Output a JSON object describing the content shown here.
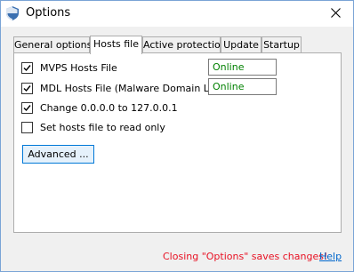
{
  "window": {
    "title": "Options",
    "icon": "shield-icon",
    "close_icon": "close-icon"
  },
  "tabs": [
    {
      "label": "General options",
      "active": false
    },
    {
      "label": "Hosts file",
      "active": true
    },
    {
      "label": "Active protection",
      "active": false
    },
    {
      "label": "Update",
      "active": false
    },
    {
      "label": "Startup",
      "active": false
    }
  ],
  "hosts_tab": {
    "options": [
      {
        "label": "MVPS Hosts File",
        "checked": true,
        "status": "Online"
      },
      {
        "label": "MDL Hosts File (Malware Domain List)",
        "checked": true,
        "status": "Online"
      },
      {
        "label": "Change 0.0.0.0 to 127.0.0.1",
        "checked": true
      },
      {
        "label": "Set hosts file to read only",
        "checked": false
      }
    ],
    "advanced_button": "Advanced ..."
  },
  "footer": {
    "note": "Closing \"Options\" saves changes!",
    "help_link": "Help"
  },
  "colors": {
    "status_online": "#008000",
    "footer_note": "#e81123",
    "link": "#0066cc",
    "accent": "#0078d7"
  }
}
